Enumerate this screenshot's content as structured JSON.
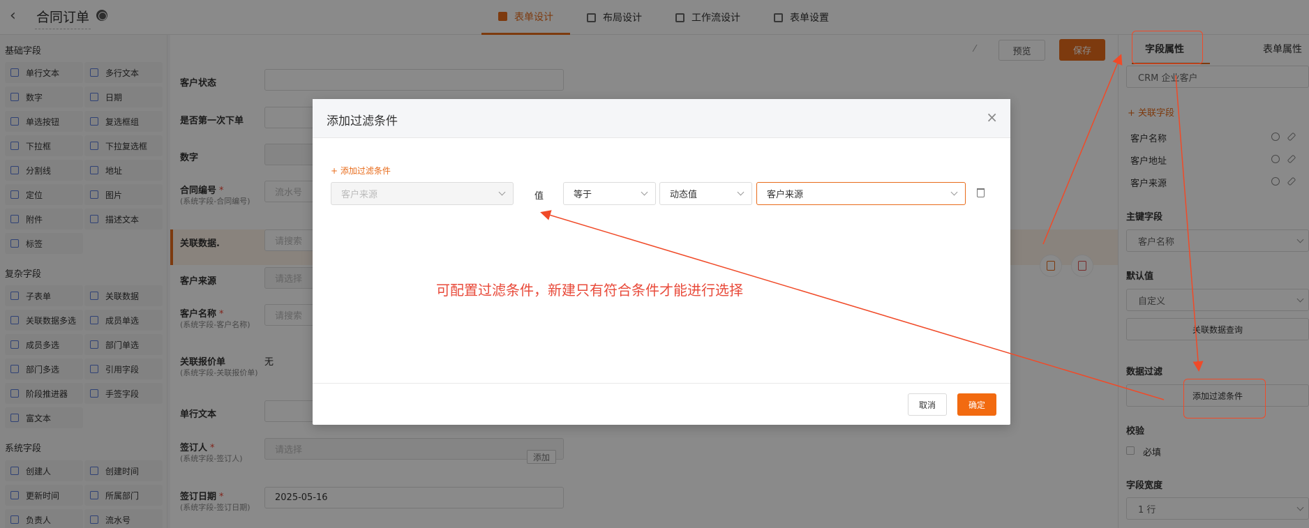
{
  "topbar": {
    "title": "合同订单",
    "tabs": [
      {
        "label": "表单设计",
        "active": true
      },
      {
        "label": "布局设计",
        "active": false
      },
      {
        "label": "工作流设计",
        "active": false
      },
      {
        "label": "表单设置",
        "active": false
      }
    ]
  },
  "palette": {
    "basic_title": "基础字段",
    "basic": [
      "单行文本",
      "多行文本",
      "数字",
      "日期",
      "单选按钮",
      "复选框组",
      "下拉框",
      "下拉复选框",
      "分割线",
      "地址",
      "定位",
      "图片",
      "附件",
      "描述文本",
      "标签"
    ],
    "complex_title": "复杂字段",
    "complex": [
      "子表单",
      "关联数据",
      "关联数据多选",
      "成员单选",
      "成员多选",
      "部门单选",
      "部门多选",
      "引用字段",
      "阶段推进器",
      "手签字段",
      "富文本"
    ],
    "system_title": "系统字段",
    "system": [
      "创建人",
      "创建时间",
      "更新时间",
      "所属部门",
      "负责人",
      "流水号"
    ]
  },
  "canvas": {
    "preview_label": "预览",
    "save_label": "保存",
    "fields": [
      {
        "label": "客户状态",
        "sub": "",
        "required": false,
        "value": "",
        "placeholder": "",
        "disabled": false
      },
      {
        "label": "是否第一次下单",
        "sub": "",
        "required": false,
        "value": "",
        "placeholder": "",
        "disabled": false
      },
      {
        "label": "数字",
        "sub": "",
        "required": false,
        "value": "",
        "placeholder": "",
        "disabled": true
      },
      {
        "label": "合同编号",
        "sub": "(系统字段-合同编号)",
        "required": true,
        "value": "",
        "placeholder": "流水号",
        "disabled": false
      },
      {
        "label": "关联数据.",
        "sub": "",
        "required": false,
        "value": "",
        "placeholder": "请搜索",
        "disabled": false
      },
      {
        "label": "客户来源",
        "sub": "",
        "required": false,
        "value": "",
        "placeholder": "请选择",
        "disabled": true
      },
      {
        "label": "客户名称",
        "sub": "(系统字段-客户名称)",
        "required": true,
        "value": "",
        "placeholder": "请搜索",
        "disabled": false
      },
      {
        "label": "关联报价单",
        "sub": "(系统字段-关联报价单)",
        "required": false,
        "value": "无",
        "placeholder": "",
        "disabled": false
      },
      {
        "label": "单行文本",
        "sub": "",
        "required": false,
        "value": "",
        "placeholder": "",
        "disabled": false
      },
      {
        "label": "签订人",
        "sub": "(系统字段-签订人)",
        "required": true,
        "value": "",
        "placeholder": "请选择",
        "disabled": true,
        "add_label": "添加"
      },
      {
        "label": "签订日期",
        "sub": "(系统字段-签订日期)",
        "required": true,
        "value": "2025-05-16",
        "placeholder": "",
        "disabled": false
      }
    ]
  },
  "right": {
    "tabs": [
      "字段属性",
      "表单属性"
    ],
    "source_value": "CRM 企业客户",
    "add_related_label": "+ 关联字段",
    "related_fields": [
      "客户名称",
      "客户地址",
      "客户来源"
    ],
    "primary_key_label": "主键字段",
    "primary_key_value": "客户名称",
    "default_label": "默认值",
    "default_value": "自定义",
    "related_query_label": "关联数据查询",
    "filter_label": "数据过滤",
    "add_filter_label": "添加过滤条件",
    "validate_label": "校验",
    "required_label": "必填",
    "width_label": "字段宽度",
    "width_value": "1 行"
  },
  "modal": {
    "title": "添加过滤条件",
    "add_condition_label": "+ 添加过滤条件",
    "field_placeholder": "客户来源",
    "value_label": "值",
    "operator": "等于",
    "value_type": "动态值",
    "value": "客户来源",
    "cancel_label": "取消",
    "ok_label": "确定"
  },
  "annotation": {
    "text": "可配置过滤条件，新建只有符合条件才能进行选择",
    "color": "#e84a3a"
  }
}
